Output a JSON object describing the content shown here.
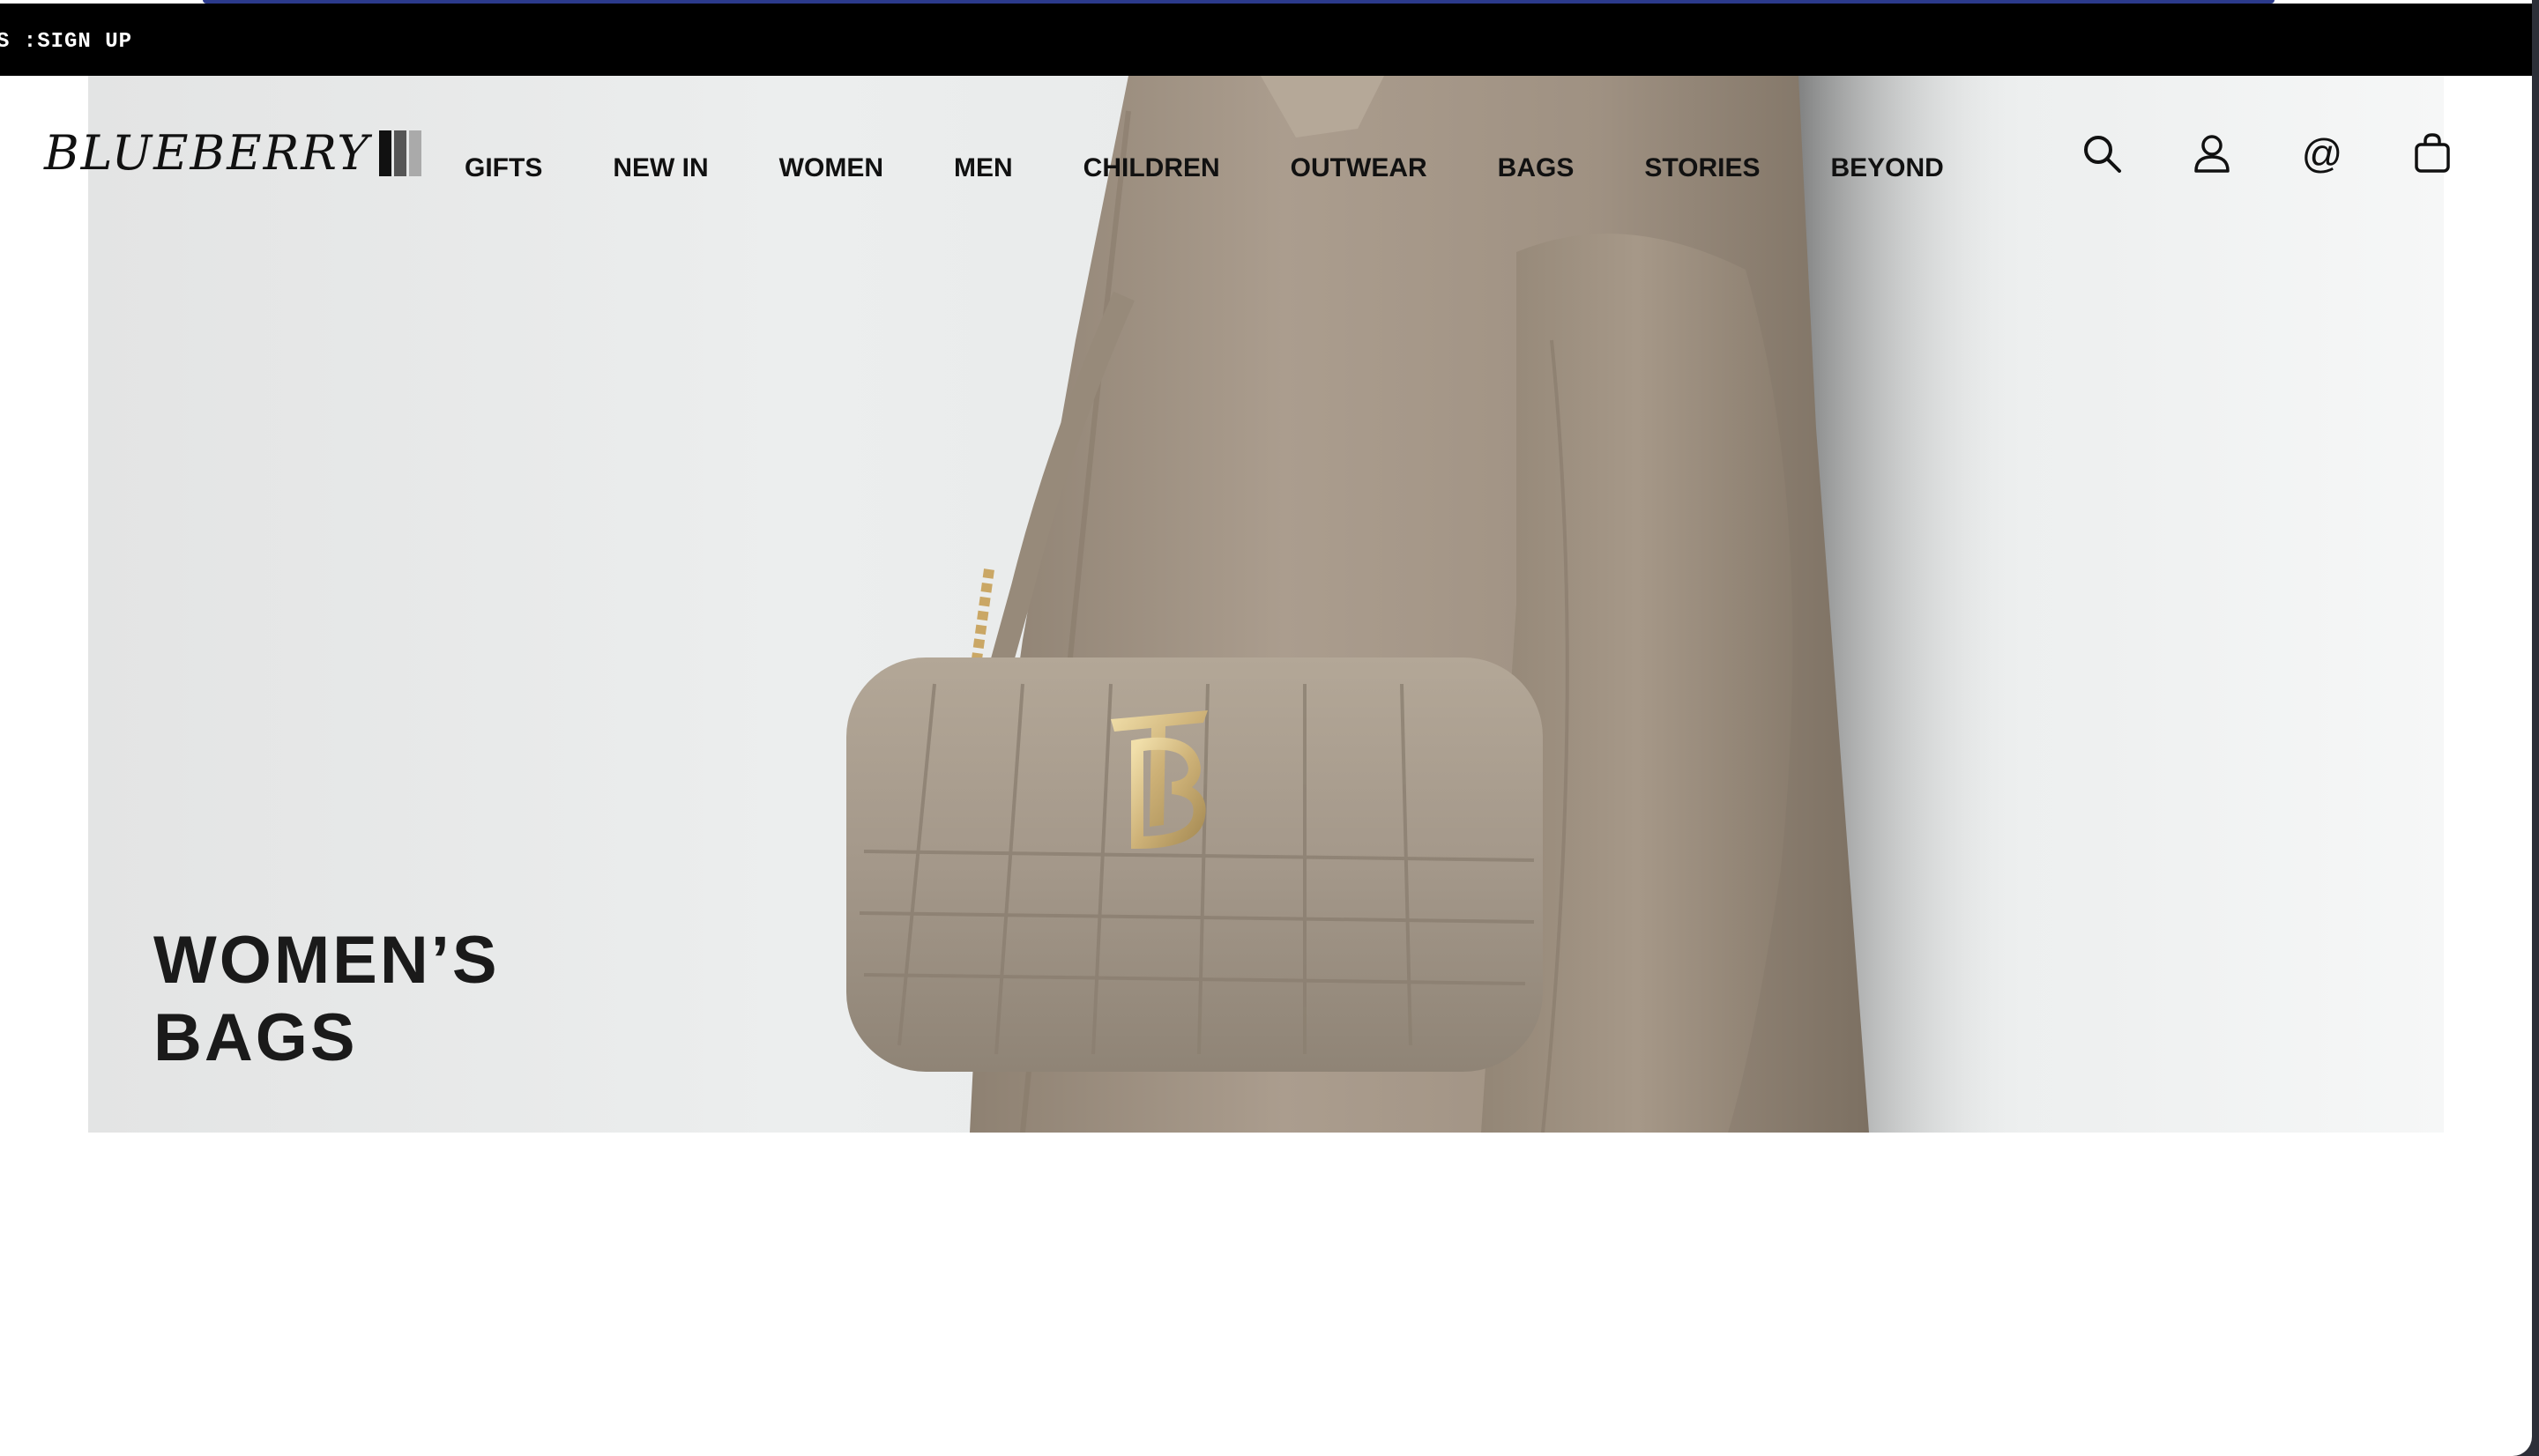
{
  "promo": {
    "text": "S :SIGN UP"
  },
  "brand": {
    "name": "BLUEBERRY"
  },
  "nav": {
    "items": [
      {
        "label": "GIFTS"
      },
      {
        "label": "NEW IN"
      },
      {
        "label": "WOMEN"
      },
      {
        "label": "MEN"
      },
      {
        "label": "CHILDREN"
      },
      {
        "label": "OUTWEAR"
      },
      {
        "label": "BAGS"
      },
      {
        "label": "STORIES"
      },
      {
        "label": "BEYOND"
      }
    ]
  },
  "header_icons": [
    "search-icon",
    "account-icon",
    "contact-icon",
    "shopping-bag-icon"
  ],
  "contact_glyph": "@",
  "hero": {
    "title_line1": "WOMEN’S",
    "title_line2": "BAGS"
  },
  "colors": {
    "promo_bg": "#000000",
    "accent": "#2b3a8c",
    "coat": "#a8998a",
    "bag": "#a69b8c",
    "logo_gold": "#d9c28a"
  }
}
